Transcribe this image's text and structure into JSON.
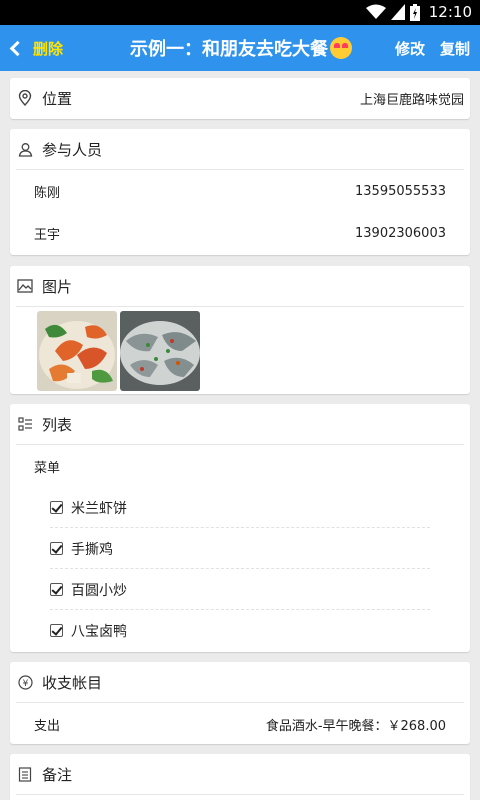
{
  "status": {
    "time": "12:10"
  },
  "appbar": {
    "back_label": "删除",
    "title": "示例一：和朋友去吃大餐",
    "edit_label": "修改",
    "copy_label": "复制"
  },
  "location": {
    "label": "位置",
    "value": "上海巨鹿路味觉园"
  },
  "participants": {
    "label": "参与人员",
    "people": [
      {
        "name": "陈刚",
        "phone": "13595055533"
      },
      {
        "name": "王宇",
        "phone": "13902306003"
      }
    ]
  },
  "images": {
    "label": "图片",
    "items": [
      "shrimp-dish-photo",
      "seafood-platter-photo"
    ]
  },
  "list": {
    "label": "列表",
    "sublabel": "菜单",
    "items": [
      {
        "label": "米兰虾饼",
        "checked": true
      },
      {
        "label": "手撕鸡",
        "checked": true
      },
      {
        "label": "百圆小炒",
        "checked": true
      },
      {
        "label": "八宝卤鸭",
        "checked": true
      }
    ]
  },
  "accounts": {
    "label": "收支帐目",
    "row": {
      "type": "支出",
      "detail": "食品酒水-早午晚餐：￥268.00"
    }
  },
  "notes": {
    "label": "备注"
  },
  "colors": {
    "appbar": "#2f93ee",
    "accent_yellow": "#ffe400",
    "background": "#ebebeb"
  }
}
